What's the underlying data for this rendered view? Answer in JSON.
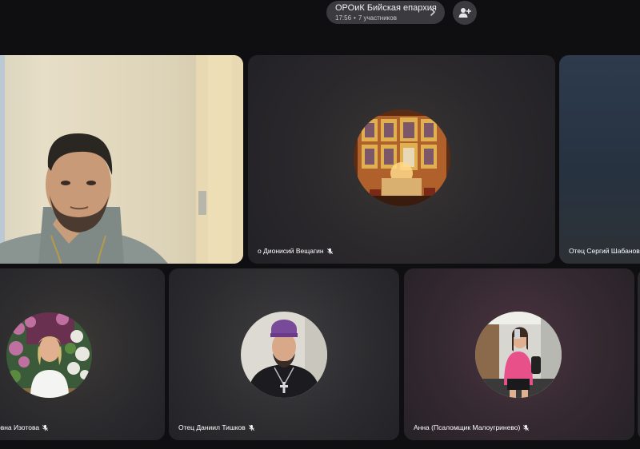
{
  "header": {
    "title": "ОРОиК Бийская епархия",
    "time": "17:56",
    "participants": "7 участников"
  },
  "tiles": [
    {
      "name": ""
    },
    {
      "name": "о Дионисий Вещагин"
    },
    {
      "name": "Отец Сергий Шабанов (А"
    },
    {
      "name": "овна Изотова"
    },
    {
      "name": "Отец Даниил Тишков"
    },
    {
      "name": "Анна (Псаломщик Малоугринево)"
    }
  ],
  "colors": {
    "background": "#0f0f11",
    "pill": "#3a3a3f",
    "tile": "#2b2a2e"
  },
  "icons": {
    "header_chevron": "chevron-right-icon",
    "add_participant": "person-add-icon",
    "muted": "mic-off-icon"
  }
}
